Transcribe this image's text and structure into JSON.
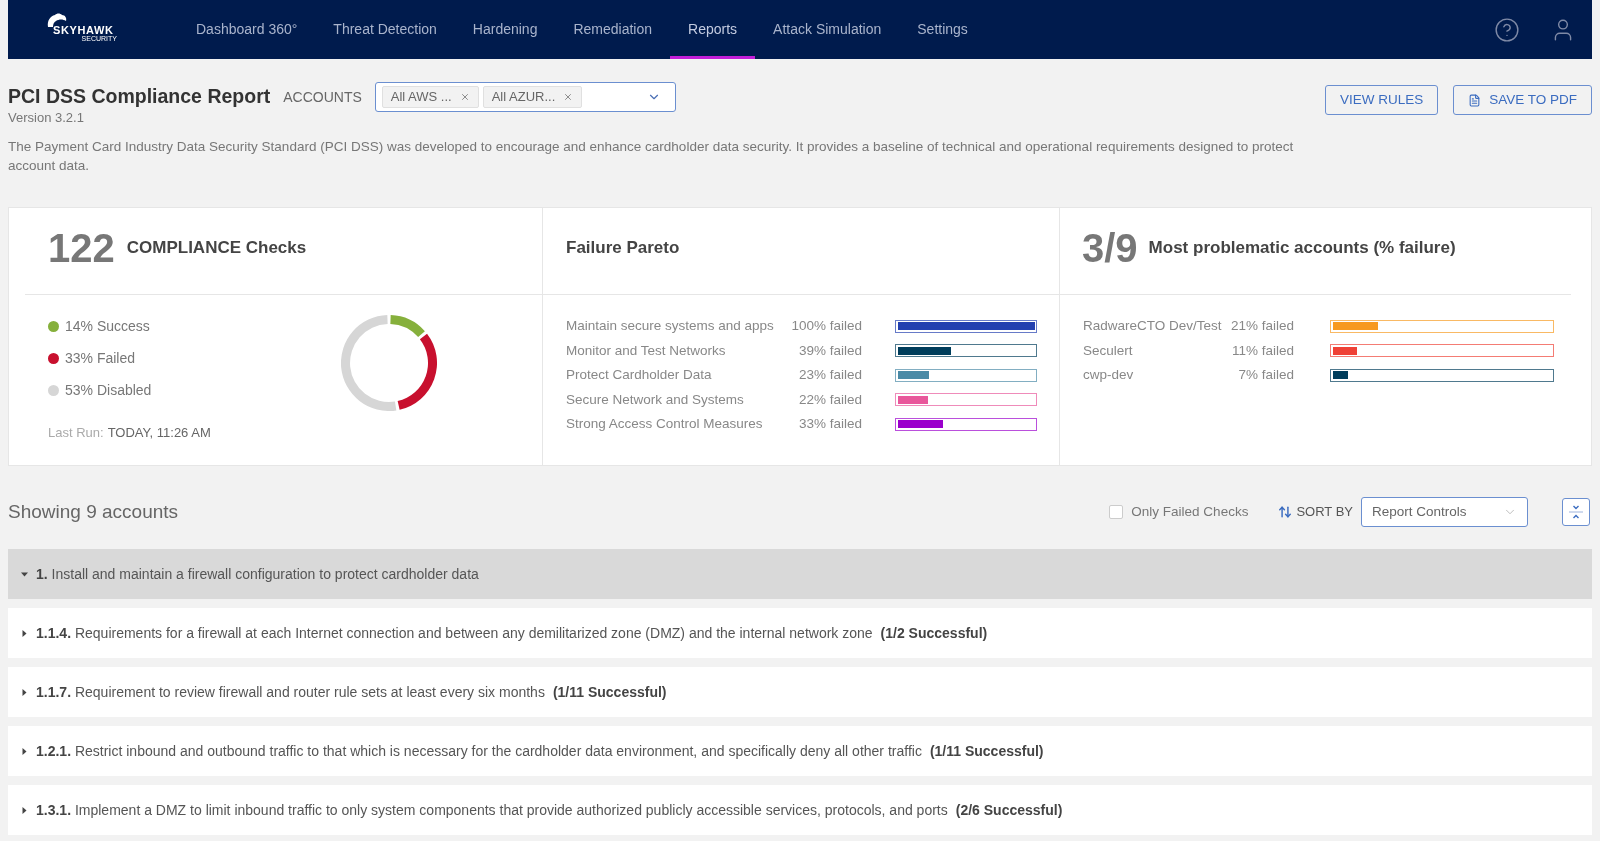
{
  "logo": {
    "name": "SKYHAWK",
    "tagline": "SECURITY"
  },
  "nav": {
    "items": [
      {
        "label": "Dashboard 360°",
        "selected": false
      },
      {
        "label": "Threat Detection",
        "selected": false
      },
      {
        "label": "Hardening",
        "selected": false
      },
      {
        "label": "Remediation",
        "selected": false
      },
      {
        "label": "Reports",
        "selected": true
      },
      {
        "label": "Attack Simulation",
        "selected": false
      },
      {
        "label": "Settings",
        "selected": false
      }
    ]
  },
  "report": {
    "title": "PCI DSS Compliance Report",
    "accounts_label": "ACCOUNTS",
    "account_chips": [
      "All AWS ...",
      "All AZUR..."
    ],
    "version": "Version 3.2.1",
    "description": "The Payment Card Industry Data Security Standard (PCI DSS) was developed to encourage and enhance cardholder data security. It provides a baseline of technical and operational requirements designed to protect account data.",
    "buttons": [
      {
        "label": "VIEW RULES",
        "kind": "plain"
      },
      {
        "label": "SAVE TO PDF",
        "kind": "pdf"
      }
    ]
  },
  "compliance": {
    "count": "122",
    "title": "COMPLIANCE Checks",
    "legend": [
      {
        "label": "14% Success",
        "color": "#86b03c"
      },
      {
        "label": "33% Failed",
        "color": "#c8102e"
      },
      {
        "label": "53% Disabled",
        "color": "#d6d6d6"
      }
    ],
    "chart_data": {
      "type": "donut",
      "values": [
        14,
        33,
        53
      ]
    },
    "last_run_label": "Last Run:",
    "last_run_value": "TODAY, 11:26 AM"
  },
  "pareto": {
    "title": "Failure Pareto",
    "items": [
      {
        "label": "Maintain secure systems and apps",
        "reading": "100% failed",
        "level": 1,
        "color": "#2340b0"
      },
      {
        "label": "Monitor and Test Networks",
        "reading": "39% failed",
        "level": 0.39,
        "color": "#003d5b"
      },
      {
        "label": "Protect Cardholder Data",
        "reading": "23% failed",
        "level": 0.23,
        "color": "#4a8aa6"
      },
      {
        "label": "Secure Network and Systems",
        "reading": "22% failed",
        "level": 0.22,
        "color": "#e8579b"
      },
      {
        "label": "Strong Access Control Measures",
        "reading": "33% failed",
        "level": 0.33,
        "color": "#9b00cc"
      }
    ]
  },
  "accounts": {
    "count": "3/9",
    "title": "Most problematic accounts (% failure)",
    "items": [
      {
        "label": "RadwareCTO Dev/Test",
        "reading": "21% failed",
        "level": 0.21,
        "color": "#f7991f"
      },
      {
        "label": "Seculert",
        "reading": "11% failed",
        "level": 0.11,
        "color": "#ef4136"
      },
      {
        "label": "cwp-dev",
        "reading": "7% failed",
        "level": 0.07,
        "color": "#003d5b"
      }
    ]
  },
  "toolbar": {
    "showing": "Showing 9 accounts",
    "only_failed": {
      "label": "Only Failed Checks",
      "checked": false
    },
    "sort_label": "SORT BY",
    "sort_value": "Report Controls"
  },
  "sections": [
    {
      "number": "1.",
      "title": "Install and maintain a firewall configuration to protect cardholder data",
      "expanded": true,
      "children": [
        {
          "number": "1.1.4.",
          "title": "Requirements for a firewall at each Internet connection and between any demilitarized zone (DMZ) and the internal network zone",
          "summary": "(1/2 Successful)",
          "expanded": false
        },
        {
          "number": "1.1.7.",
          "title": "Requirement to review firewall and router rule sets at least every six months",
          "summary": "(1/11 Successful)",
          "expanded": false
        },
        {
          "number": "1.2.1.",
          "title": "Restrict inbound and outbound traffic to that which is necessary for the cardholder data environment, and specifically deny all other traffic",
          "summary": "(1/11 Successful)",
          "expanded": false
        },
        {
          "number": "1.3.1.",
          "title": "Implement a DMZ to limit inbound traffic to only system components that provide authorized publicly accessible services, protocols, and ports",
          "summary": "(2/6 Successful)",
          "expanded": false
        }
      ]
    }
  ]
}
